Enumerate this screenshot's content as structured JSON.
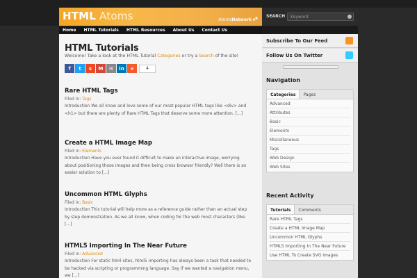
{
  "logo": {
    "bold": "HTML",
    "light": " Atoms"
  },
  "network": {
    "light": "Atoms",
    "bold": "Network"
  },
  "search": {
    "label": "SEARCH",
    "placeholder": "Keyword"
  },
  "nav": [
    "Home",
    "HTML Tutorials",
    "HTML Resources",
    "About Us",
    "Contact Us"
  ],
  "page": {
    "title": "HTML Tutorials",
    "welcome": {
      "pre": "Welcome! Take a look at the HTML Tutorial ",
      "link1": "Categories",
      "mid": " or try a ",
      "link2": "Search",
      "post": " of the site!"
    }
  },
  "share": {
    "buttons": [
      {
        "name": "facebook",
        "glyph": "f",
        "color": "#3b5998"
      },
      {
        "name": "twitter",
        "glyph": "t",
        "color": "#1da1f2"
      },
      {
        "name": "stumbleupon",
        "glyph": "s",
        "color": "#eb4823"
      },
      {
        "name": "gmail",
        "glyph": "M",
        "color": "#d44638"
      },
      {
        "name": "email",
        "glyph": "✉",
        "color": "#888888"
      },
      {
        "name": "linkedin",
        "glyph": "in",
        "color": "#0077b5"
      },
      {
        "name": "more",
        "glyph": "+",
        "color": "#f35b2a"
      }
    ],
    "count": "4"
  },
  "posts": [
    {
      "title": "Rare HTML Tags",
      "filed_label": "Filed in: ",
      "category": "Tags",
      "excerpt": "Introduction We all know and love some of our most popular HTML tags like <div> and <h1> but there are plenty of Rare HTML Tags that deserve some more attention. [...]"
    },
    {
      "title": "Create a HTML Image Map",
      "filed_label": "Filed in: ",
      "category": "Elements",
      "excerpt": "Introduction Have you ever found it difficult to make an interactive image, worrying about positioning those images and then being cross browser friendly? Well there is an easier solution to [...]"
    },
    {
      "title": "Uncommon HTML Glyphs",
      "filed_label": "Filed in: ",
      "category": "Basic",
      "excerpt": "Introduction This tutorial will help more as a reference guide rather than an actual step by step demonstration. As we all know, when coding for the web most characters (like [...]"
    },
    {
      "title": "HTML5 Importing In The Near Future",
      "filed_label": "Filed in: ",
      "category": "Advanced",
      "excerpt": "Introduction For static html sites, html5 importing has always been a task that needed to be hacked via scripting or programming language. Say if we wanted a navigation menu, we [...]"
    }
  ],
  "sidebar": {
    "feed_label": "Subscribe To Our Feed",
    "twitter_label": "Follow Us On Twitter",
    "navigation_heading": "Navigation",
    "nav_tabs": [
      "Categories",
      "Pages"
    ],
    "categories": [
      "Advanced",
      "Attributes",
      "Basic",
      "Elements",
      "Miscellaneous",
      "Tags",
      "Web Design",
      "Web Sites"
    ],
    "activity_heading": "Recent Activity",
    "activity_tabs": [
      "Tutorials",
      "Comments"
    ],
    "tutorials": [
      "Rare HTML Tags",
      "Create a HTML Image Map",
      "Uncommon HTML Glyphs",
      "HTML5 Importing In The Near Future",
      "Use HTML To Create SVG Images"
    ]
  },
  "colors": {
    "accent": "#e28a10",
    "rss": "#f7941d",
    "twitter": "#33ccff"
  }
}
